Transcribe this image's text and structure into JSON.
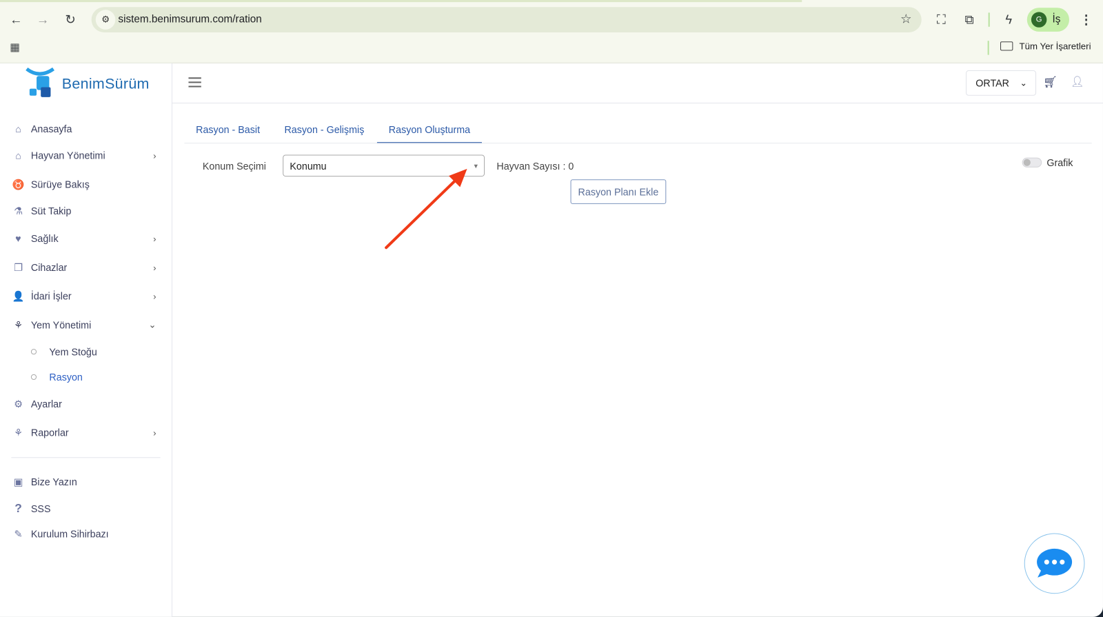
{
  "browser": {
    "url": "sistem.benimsurum.com/ration",
    "profile_initial": "G",
    "profile_label": "İş",
    "bookmarks_label": "Tüm Yer İşaretleri"
  },
  "logo": {
    "text": "BenimSürüm"
  },
  "header": {
    "farm_select": "ORTAR"
  },
  "sidebar": {
    "items": [
      {
        "label": "Anasayfa",
        "icon": "home-icon"
      },
      {
        "label": "Hayvan Yönetimi",
        "icon": "barn-icon"
      },
      {
        "label": "Sürüye Bakış",
        "icon": "cow-icon"
      },
      {
        "label": "Süt Takip",
        "icon": "flask-icon"
      },
      {
        "label": "Sağlık",
        "icon": "hand-heart-icon"
      },
      {
        "label": "Cihazlar",
        "icon": "devices-icon"
      },
      {
        "label": "İdari İşler",
        "icon": "user-gear-icon"
      },
      {
        "label": "Yem Yönetimi",
        "icon": "feed-icon"
      },
      {
        "label": "Ayarlar",
        "icon": "gear-icon"
      },
      {
        "label": "Raporlar",
        "icon": "report-icon"
      },
      {
        "label": "Bize Yazın",
        "icon": "support-icon"
      },
      {
        "label": "SSS",
        "icon": "question-icon"
      },
      {
        "label": "Kurulum Sihirbazı",
        "icon": "wand-icon"
      }
    ],
    "subitems": [
      {
        "label": "Yem Stoğu"
      },
      {
        "label": "Rasyon",
        "active": true
      }
    ]
  },
  "tabs": [
    {
      "label": "Rasyon - Basit"
    },
    {
      "label": "Rasyon - Gelişmiş"
    },
    {
      "label": "Rasyon Oluşturma",
      "active": true
    }
  ],
  "form": {
    "location_label": "Konum Seçimi",
    "location_value": "Konumu",
    "animal_count": "Hayvan Sayısı : 0",
    "add_button": "Rasyon Planı Ekle",
    "chart_toggle_label": "Grafik",
    "chart_toggle_on": false
  },
  "colors": {
    "accent": "#2c5aa8",
    "annotation_arrow": "#f03a17",
    "chat": "#1a8cf0"
  }
}
